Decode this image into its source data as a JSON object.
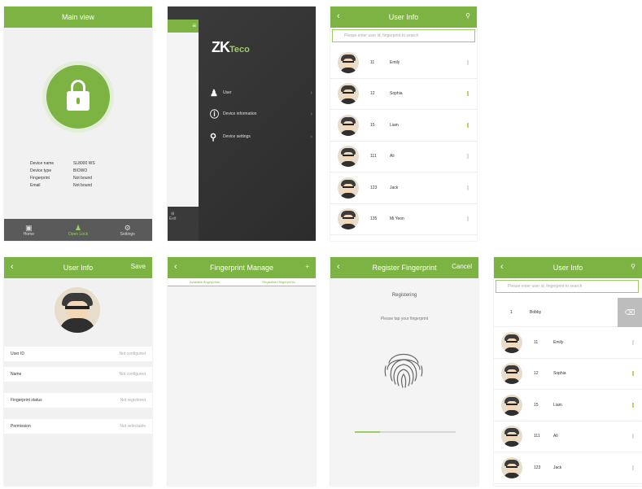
{
  "colors": {
    "accent": "#7cb342",
    "light_accent": "#9ccc65",
    "dark_panel": "#3a3a3a",
    "nav_bg": "#5a5a5a"
  },
  "screen1": {
    "title": "Main view",
    "icon": "lock-icon",
    "info": [
      {
        "key": "Device name",
        "value": "SL8000 WS"
      },
      {
        "key": "Device type",
        "value": "BIOWO"
      },
      {
        "key": "Fingerprint",
        "value": "Not bound"
      },
      {
        "key": "Email",
        "value": "Not bound"
      }
    ],
    "nav": [
      {
        "label": "Home",
        "icon": "lock-icon"
      },
      {
        "label": "Open Lock",
        "icon": "person-icon"
      },
      {
        "label": "Settings",
        "icon": "gear-icon"
      }
    ]
  },
  "screen2": {
    "menu_button": "≡",
    "logo": "ZK",
    "logo_suffix": "Teco",
    "menu": [
      {
        "label": "User",
        "icon": "person-icon"
      },
      {
        "label": "Device information",
        "icon": "info-icon"
      },
      {
        "label": "Device settings",
        "icon": "search-icon"
      }
    ],
    "exit_label": "Exit"
  },
  "screen3": {
    "title": "User Info",
    "search_placeholder": "Please enter user id, fingerprint to search",
    "users": [
      {
        "id": "11",
        "name": "Emily",
        "fp": false
      },
      {
        "id": "12",
        "name": "Sophia",
        "fp": true
      },
      {
        "id": "15",
        "name": "Liam",
        "fp": true
      },
      {
        "id": "111",
        "name": "Ali",
        "fp": false
      },
      {
        "id": "123",
        "name": "Jack",
        "fp": false
      },
      {
        "id": "135",
        "name": "Mi Yeon",
        "fp": false
      }
    ]
  },
  "screen4": {
    "title": "User Info",
    "action": "Save",
    "fields": [
      {
        "label": "User ID",
        "value": "Not configured"
      },
      {
        "label": "Name",
        "value": "Not configured"
      },
      {
        "label": "Fingerprint status",
        "value": "Not registered"
      },
      {
        "label": "Permission",
        "value": "Not selectable"
      }
    ]
  },
  "screen5": {
    "title": "Fingerprint Manage",
    "tabs": [
      "Available fingerprints",
      "Registered fingerprints"
    ]
  },
  "screen6": {
    "title": "Register Fingerprint",
    "action": "Cancel",
    "status": "Registering",
    "hint": "Please tap your fingerprint",
    "progress": 0.25
  },
  "screen7": {
    "title": "User Info",
    "search_placeholder": "Please enter user id, fingerprint to search",
    "swiped": {
      "id": "1",
      "name": "Bobby",
      "delete_icon": "trash-icon"
    },
    "users": [
      {
        "id": "11",
        "name": "Emily",
        "fp": false
      },
      {
        "id": "12",
        "name": "Sophia",
        "fp": true
      },
      {
        "id": "15",
        "name": "Liam",
        "fp": true
      },
      {
        "id": "111",
        "name": "Ali",
        "fp": false
      },
      {
        "id": "123",
        "name": "Jack",
        "fp": false
      }
    ]
  }
}
